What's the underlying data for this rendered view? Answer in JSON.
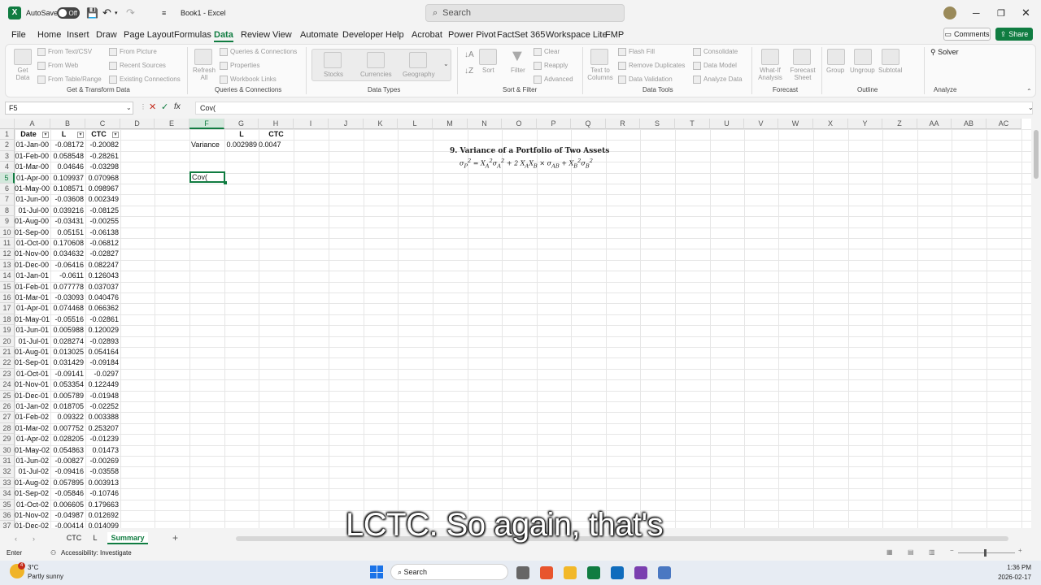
{
  "titlebar": {
    "autosave_label": "AutoSave",
    "autosave_state": "Off",
    "doc_title": "Book1 - Excel",
    "search_placeholder": "Search"
  },
  "menu": {
    "items": [
      "File",
      "Home",
      "Insert",
      "Draw",
      "Page Layout",
      "Formulas",
      "Data",
      "Review",
      "View",
      "Automate",
      "Developer",
      "Help",
      "Acrobat",
      "Power Pivot",
      "FactSet 365",
      "Workspace Lite",
      "FMP"
    ],
    "active": "Data",
    "comments_label": "Comments",
    "share_label": "Share"
  },
  "ribbon": {
    "get_data": "Get Data",
    "from_text_csv": "From Text/CSV",
    "from_web": "From Web",
    "from_table_range": "From Table/Range",
    "from_picture": "From Picture",
    "recent_sources": "Recent Sources",
    "existing_connections": "Existing Connections",
    "refresh_all": "Refresh All",
    "queries_connections": "Queries & Connections",
    "properties": "Properties",
    "workbook_links": "Workbook Links",
    "stocks": "Stocks",
    "currencies": "Currencies",
    "geography": "Geography",
    "sort": "Sort",
    "filter": "Filter",
    "clear": "Clear",
    "reapply": "Reapply",
    "advanced": "Advanced",
    "text_to_columns": "Text to Columns",
    "flash_fill": "Flash Fill",
    "remove_duplicates": "Remove Duplicates",
    "data_validation": "Data Validation",
    "consolidate": "Consolidate",
    "data_model": "Data Model",
    "analyze_data": "Analyze Data",
    "what_if": "What-If Analysis",
    "forecast_sheet": "Forecast Sheet",
    "group": "Group",
    "ungroup": "Ungroup",
    "subtotal": "Subtotal",
    "solver": "Solver",
    "groups": [
      "Get & Transform Data",
      "Queries & Connections",
      "Data Types",
      "Sort & Filter",
      "Data Tools",
      "Forecast",
      "Outline",
      "Analyze"
    ]
  },
  "formula_bar": {
    "name_box": "F5",
    "fx": "fx",
    "content": "Cov("
  },
  "columns": [
    "A",
    "B",
    "C",
    "D",
    "E",
    "F",
    "G",
    "H",
    "I",
    "J",
    "K",
    "L",
    "M",
    "N",
    "O",
    "P",
    "Q",
    "R",
    "S",
    "T",
    "U",
    "V",
    "W",
    "X",
    "Y",
    "Z",
    "AA",
    "AB",
    "AC"
  ],
  "table": {
    "headers": [
      "Date",
      "L",
      "CTC"
    ],
    "rows": [
      [
        "01-Jan-00",
        "-0.08172",
        "-0.20082"
      ],
      [
        "01-Feb-00",
        "0.058548",
        "-0.28261"
      ],
      [
        "01-Mar-00",
        "0.04646",
        "-0.03298"
      ],
      [
        "01-Apr-00",
        "0.109937",
        "0.070968"
      ],
      [
        "01-May-00",
        "0.108571",
        "0.098967"
      ],
      [
        "01-Jun-00",
        "-0.03608",
        "0.002349"
      ],
      [
        "01-Jul-00",
        "0.039216",
        "-0.08125"
      ],
      [
        "01-Aug-00",
        "-0.03431",
        "-0.00255"
      ],
      [
        "01-Sep-00",
        "0.05151",
        "-0.06138"
      ],
      [
        "01-Oct-00",
        "0.170608",
        "-0.06812"
      ],
      [
        "01-Nov-00",
        "0.034632",
        "-0.02827"
      ],
      [
        "01-Dec-00",
        "-0.06416",
        "0.082247"
      ],
      [
        "01-Jan-01",
        "-0.0611",
        "0.126043"
      ],
      [
        "01-Feb-01",
        "0.077778",
        "0.037037"
      ],
      [
        "01-Mar-01",
        "-0.03093",
        "0.040476"
      ],
      [
        "01-Apr-01",
        "0.074468",
        "0.066362"
      ],
      [
        "01-May-01",
        "-0.05516",
        "-0.02861"
      ],
      [
        "01-Jun-01",
        "0.005988",
        "0.120029"
      ],
      [
        "01-Jul-01",
        "0.028274",
        "-0.02893"
      ],
      [
        "01-Aug-01",
        "0.013025",
        "0.054164"
      ],
      [
        "01-Sep-01",
        "0.031429",
        "-0.09184"
      ],
      [
        "01-Oct-01",
        "-0.09141",
        "-0.0297"
      ],
      [
        "01-Nov-01",
        "0.053354",
        "0.122449"
      ],
      [
        "01-Dec-01",
        "0.005789",
        "-0.01948"
      ],
      [
        "01-Jan-02",
        "0.018705",
        "-0.02252"
      ],
      [
        "01-Feb-02",
        "0.09322",
        "0.003388"
      ],
      [
        "01-Mar-02",
        "0.007752",
        "0.253207"
      ],
      [
        "01-Apr-02",
        "0.028205",
        "-0.01239"
      ],
      [
        "01-May-02",
        "0.054863",
        "0.01473"
      ],
      [
        "01-Jun-02",
        "-0.00827",
        "-0.00269"
      ],
      [
        "01-Jul-02",
        "-0.09416",
        "-0.03558"
      ],
      [
        "01-Aug-02",
        "0.057895",
        "0.003913"
      ],
      [
        "01-Sep-02",
        "-0.05846",
        "-0.10746"
      ],
      [
        "01-Oct-02",
        "0.006605",
        "0.179663"
      ],
      [
        "01-Nov-02",
        "-0.04987",
        "0.012692"
      ],
      [
        "01-Dec-02",
        "-0.00414",
        "0.014099"
      ]
    ]
  },
  "summary": {
    "hdr_l": "L",
    "hdr_ctc": "CTC",
    "variance_label": "Variance",
    "variance_l": "0.002989",
    "variance_ctc": "0.0047",
    "active_cell_text": "Cov("
  },
  "note": {
    "title": "9.  Variance of a Portfolio of Two Assets"
  },
  "sheets": [
    "CTC",
    "L",
    "Summary"
  ],
  "active_sheet": "Summary",
  "status": {
    "mode": "Enter",
    "accessibility": "Accessibility: Investigate"
  },
  "taskbar": {
    "temp": "3°C",
    "weather": "Partly sunny",
    "badge": "4",
    "search": "Search",
    "time": "1:36 PM",
    "date": "2026-02-17"
  },
  "caption": "LCTC. So again, that's",
  "colors": {
    "accent": "#107c41"
  }
}
